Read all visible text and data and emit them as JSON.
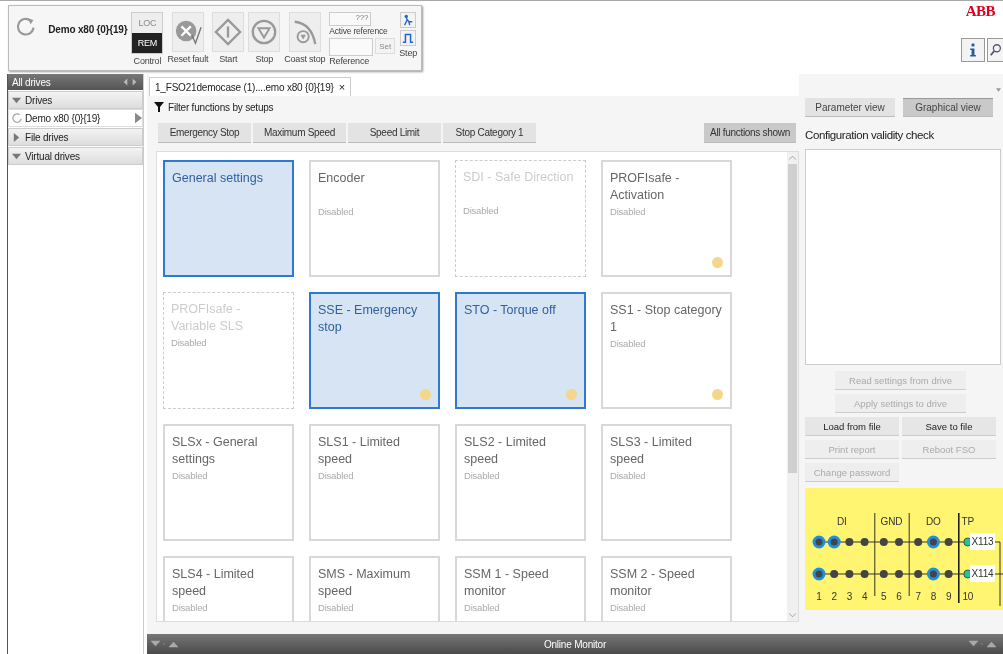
{
  "drive": {
    "name": "Demo x80 {0}{19}"
  },
  "control": {
    "caption": "Control",
    "options": [
      {
        "label": "LOC",
        "selected": false
      },
      {
        "label": "REM",
        "selected": true
      }
    ]
  },
  "commands": [
    {
      "kind": "reset",
      "label": "Reset fault"
    },
    {
      "kind": "start",
      "label": "Start"
    },
    {
      "kind": "stop",
      "label": "Stop"
    },
    {
      "kind": "coast",
      "label": "Coast stop"
    }
  ],
  "reference": {
    "active_value": "???",
    "active_label": "Active reference",
    "set_button": "Set",
    "caption": "Reference"
  },
  "step": {
    "caption": "Step"
  },
  "brand": "ABB",
  "sidebar": {
    "title": "All drives",
    "groups": [
      {
        "label": "Drives",
        "expanded": true,
        "children": [
          {
            "label": "Demo x80 {0}{19}",
            "selected": true
          }
        ]
      },
      {
        "label": "File drives",
        "expanded": false
      },
      {
        "label": "Virtual drives",
        "expanded": true
      }
    ]
  },
  "document_tab": {
    "label": "1_FSO21democase (1)....emo x80 {0}{19}",
    "close": "×"
  },
  "filter": {
    "label": "Filter functions by setups",
    "setups": [
      {
        "label": "Emergency Stop",
        "selected": false
      },
      {
        "label": "Maximum Speed",
        "selected": false
      },
      {
        "label": "Speed Limit",
        "selected": false
      },
      {
        "label": "Stop Category 1",
        "selected": false
      }
    ],
    "all_button": {
      "label": "All functions shown",
      "selected": true
    }
  },
  "functions": [
    {
      "title": "General settings",
      "kind": "active",
      "warning": false
    },
    {
      "title": "Encoder",
      "kind": "normal",
      "status": "Disabled",
      "warning": false
    },
    {
      "title": "SDI - Safe Direction",
      "kind": "unavailable",
      "status": "Disabled",
      "warning": false
    },
    {
      "title": "PROFIsafe - Activation",
      "kind": "normal",
      "status": "Disabled",
      "warning": true
    },
    {
      "title": "PROFIsafe - Variable SLS",
      "kind": "unavailable",
      "status": "Disabled",
      "warning": false
    },
    {
      "title": "SSE - Emergency stop",
      "kind": "active",
      "warning": true
    },
    {
      "title": "STO - Torque off",
      "kind": "active",
      "warning": true
    },
    {
      "title": "SS1 - Stop category 1",
      "kind": "normal",
      "status": "Disabled",
      "warning": true
    },
    {
      "title": "SLSx - General settings",
      "kind": "normal",
      "status": "Disabled",
      "warning": false
    },
    {
      "title": "SLS1 - Limited speed",
      "kind": "normal",
      "status": "Disabled",
      "warning": false
    },
    {
      "title": "SLS2 - Limited speed",
      "kind": "normal",
      "status": "Disabled",
      "warning": false
    },
    {
      "title": "SLS3 - Limited speed",
      "kind": "normal",
      "status": "Disabled",
      "warning": false
    },
    {
      "title": "SLS4 - Limited speed",
      "kind": "normal",
      "status": "Disabled"
    },
    {
      "title": "SMS - Maximum speed",
      "kind": "normal",
      "status": "Disabled"
    },
    {
      "title": "SSM 1 - Speed monitor",
      "kind": "normal",
      "status": "Disabled"
    },
    {
      "title": "SSM 2 - Speed monitor",
      "kind": "normal",
      "status": "Disabled"
    }
  ],
  "views": [
    {
      "label": "Parameter view",
      "selected": false
    },
    {
      "label": "Graphical view",
      "selected": true
    }
  ],
  "validity": {
    "title": "Configuration validity check"
  },
  "actions": [
    {
      "label": "Read settings from drive",
      "kind": "wide",
      "disabled": true
    },
    {
      "label": "Apply settings to drive",
      "kind": "wide",
      "disabled": true
    },
    {
      "label": "Load from file",
      "kind": "half",
      "disabled": false
    },
    {
      "label": "Save to file",
      "kind": "half",
      "disabled": false
    },
    {
      "label": "Print report",
      "kind": "half",
      "disabled": true
    },
    {
      "label": "Reboot FSO",
      "kind": "half",
      "disabled": true
    },
    {
      "label": "Change password",
      "kind": "half",
      "disabled": true
    }
  ],
  "terminals": {
    "groups": [
      {
        "label": "DI",
        "kind": "di",
        "pins": [
          "1",
          "2",
          "3",
          "4"
        ]
      },
      {
        "label": "GND",
        "kind": "gnd",
        "pins": [
          "5",
          "6"
        ]
      },
      {
        "label": "DO",
        "kind": "do",
        "pins": [
          "7",
          "8",
          "9"
        ]
      },
      {
        "label": "TP",
        "kind": "tp",
        "pins": [
          "10"
        ]
      }
    ],
    "connectors": [
      {
        "label": "X113",
        "active": [
          true,
          true,
          false,
          false,
          false,
          false,
          false,
          true,
          false,
          false
        ]
      },
      {
        "label": "X114",
        "active": [
          true,
          false,
          false,
          false,
          false,
          false,
          false,
          true,
          false,
          false
        ]
      }
    ]
  },
  "monitor": {
    "title": "Online Monitor"
  }
}
